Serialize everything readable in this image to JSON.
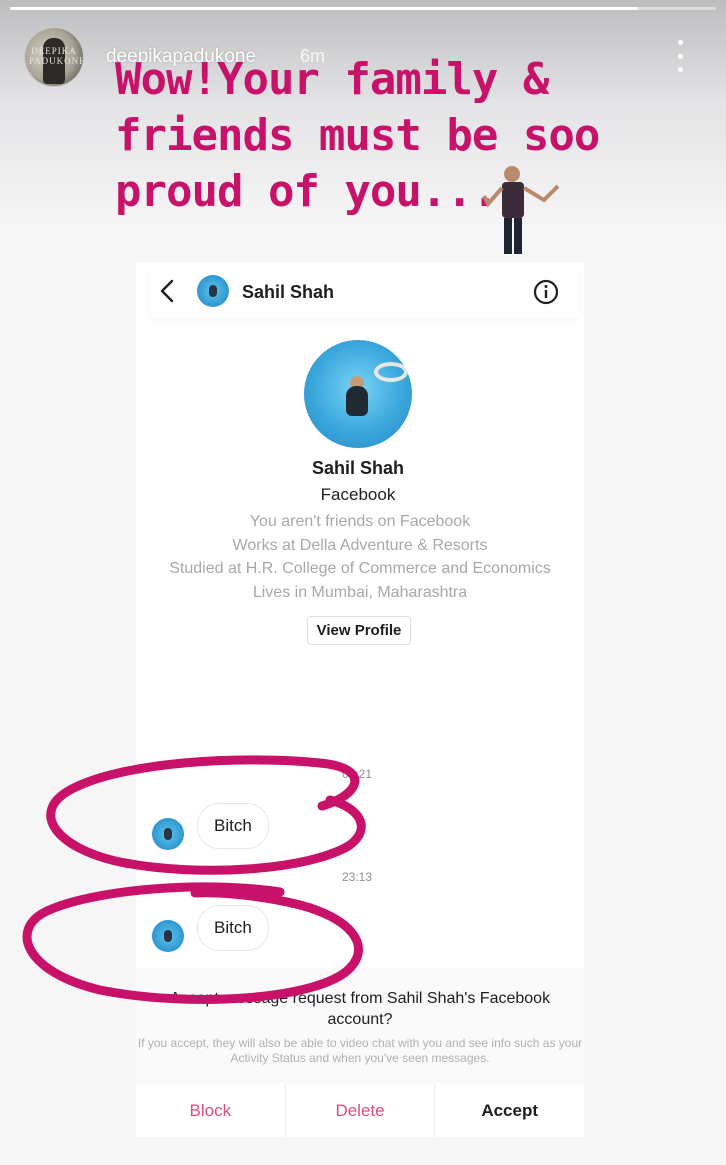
{
  "story": {
    "username": "deepikapadukone",
    "time": "6m",
    "avatar_text": "DEEPIKA PADUKONE",
    "progress": 0.89,
    "caption_lines": [
      "Wow!Your family &",
      "friends must be soo",
      "proud of you..."
    ],
    "annotation_color": "#c8126a"
  },
  "messenger": {
    "header_name": "Sahil Shah",
    "profile": {
      "name": "Sahil Shah",
      "source": "Facebook",
      "details": [
        "You aren't friends on Facebook",
        "Works at Della Adventure & Resorts",
        "Studied at H.R. College of Commerce and Economics",
        "Lives in Mumbai, Maharashtra"
      ],
      "view_profile_label": "View Profile"
    },
    "messages": [
      {
        "timestamp": "00:21",
        "text": "Bitch"
      },
      {
        "timestamp": "23:13",
        "text": "Bitch"
      }
    ],
    "request": {
      "title": "Accept message request from Sahil Shah's Facebook account?",
      "note": "If you accept, they will also be able to video chat with you and see info such as your Activity Status and when you've seen messages."
    },
    "actions": {
      "block": "Block",
      "delete": "Delete",
      "accept": "Accept"
    },
    "colors": {
      "danger": "#d94f7a",
      "text": "#1c1e21"
    }
  }
}
